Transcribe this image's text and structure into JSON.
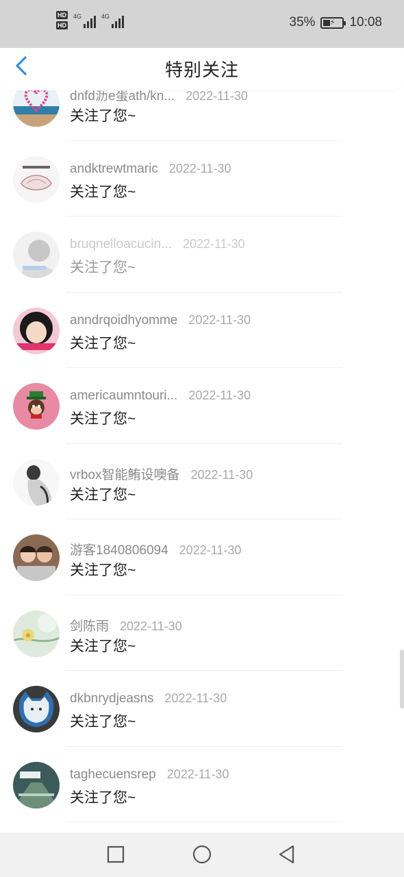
{
  "status_bar": {
    "hd1": "HD",
    "hd2": "HD",
    "net1": "4G",
    "net2": "4G",
    "battery": "35%",
    "battery_level": 0.35,
    "time": "10:08"
  },
  "header": {
    "back_icon": "chevron-left-icon",
    "title": "特别关注"
  },
  "items": [
    {
      "name": "dnfd沥e蛋ath/kn...",
      "date": "2022-11-30",
      "message": "关注了您~",
      "faded": false
    },
    {
      "name": "andktrewtmaric",
      "date": "2022-11-30",
      "message": "关注了您~",
      "faded": false
    },
    {
      "name": "bruqnelloacucin...",
      "date": "2022-11-30",
      "message": "关注了您~",
      "faded": true
    },
    {
      "name": "anndrqoidhyomme",
      "date": "2022-11-30",
      "message": "关注了您~",
      "faded": false
    },
    {
      "name": "americaumntouri...",
      "date": "2022-11-30",
      "message": "关注了您~",
      "faded": false
    },
    {
      "name": "vrbox智能鲔设噢备",
      "date": "2022-11-30",
      "message": "关注了您~",
      "faded": false
    },
    {
      "name": "游客1840806094",
      "date": "2022-11-30",
      "message": "关注了您~",
      "faded": false
    },
    {
      "name": "剑陈雨",
      "date": "2022-11-30",
      "message": "关注了您~",
      "faded": false
    },
    {
      "name": "dkbnrydjeasns",
      "date": "2022-11-30",
      "message": "关注了您~",
      "faded": false
    },
    {
      "name": "taghecuensrep",
      "date": "2022-11-30",
      "message": "关注了您~",
      "faded": false
    }
  ],
  "nav": {
    "recent_icon": "square-recents-icon",
    "home_icon": "circle-home-icon",
    "back_icon": "triangle-back-icon"
  },
  "colors": {
    "accent": "#2f8ee0",
    "status_bar_bg": "#d4d4d4",
    "name_text": "#8a8a8a",
    "message_text": "#1f1f1f"
  }
}
